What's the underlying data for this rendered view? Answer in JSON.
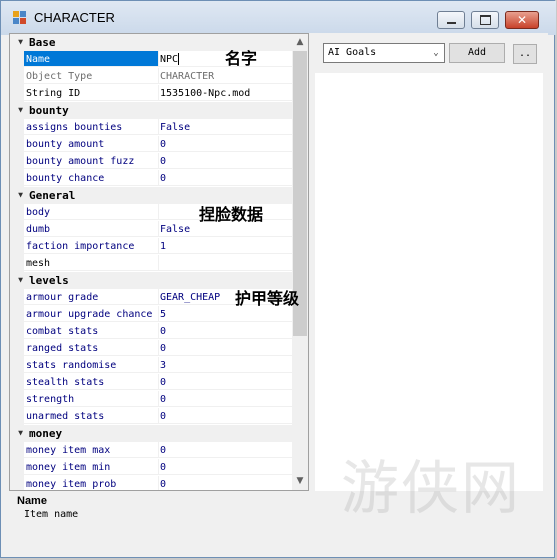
{
  "window": {
    "title": "CHARACTER",
    "icon": "character-app-icon",
    "controls": {
      "minimize_icon": "minimize-icon",
      "maximize_icon": "maximize-icon",
      "close_icon": "close-icon"
    }
  },
  "grid": {
    "sections": [
      {
        "name": "Base",
        "expanded": true,
        "props": [
          {
            "name": "Name",
            "value": "NPC",
            "state": "selected-editing"
          },
          {
            "name": "Object Type",
            "value": "CHARACTER",
            "state": "readonly"
          },
          {
            "name": "String ID",
            "value": "1535100-Npc.mod",
            "state": "plain"
          }
        ]
      },
      {
        "name": "bounty",
        "expanded": true,
        "props": [
          {
            "name": "assigns bounties",
            "value": "False"
          },
          {
            "name": "bounty amount",
            "value": "0"
          },
          {
            "name": "bounty amount fuzz",
            "value": "0"
          },
          {
            "name": "bounty chance",
            "value": "0"
          }
        ]
      },
      {
        "name": "General",
        "expanded": true,
        "props": [
          {
            "name": "body",
            "value": ""
          },
          {
            "name": "dumb",
            "value": "False"
          },
          {
            "name": "faction importance",
            "value": "1"
          },
          {
            "name": "mesh",
            "value": "",
            "state": "plain"
          }
        ]
      },
      {
        "name": "levels",
        "expanded": true,
        "props": [
          {
            "name": "armour grade",
            "value": "GEAR_CHEAP"
          },
          {
            "name": "armour upgrade chance",
            "value": "5"
          },
          {
            "name": "combat stats",
            "value": "0"
          },
          {
            "name": "ranged stats",
            "value": "0"
          },
          {
            "name": "stats randomise",
            "value": "3"
          },
          {
            "name": "stealth stats",
            "value": "0"
          },
          {
            "name": "strength",
            "value": "0"
          },
          {
            "name": "unarmed stats",
            "value": "0"
          }
        ]
      },
      {
        "name": "money",
        "expanded": true,
        "props": [
          {
            "name": "money item max",
            "value": "0"
          },
          {
            "name": "money item min",
            "value": "0"
          },
          {
            "name": "money item prob",
            "value": "0"
          }
        ]
      }
    ],
    "scroll_up_icon": "scroll-up-arrow-icon",
    "scroll_down_icon": "scroll-down-arrow-icon"
  },
  "description": {
    "title": "Name",
    "text": "Item name"
  },
  "ai_panel": {
    "selected": "AI Goals",
    "add_label": "Add",
    "more_label": ".."
  },
  "annotations": {
    "name_cn": "名字",
    "face_data_cn": "捏脸数据",
    "armour_level_cn": "护甲等级"
  },
  "watermark": "游侠网",
  "colors": {
    "selection": "#0078d7",
    "property_text": "#00007f",
    "readonly_text": "#6d6d6d"
  }
}
